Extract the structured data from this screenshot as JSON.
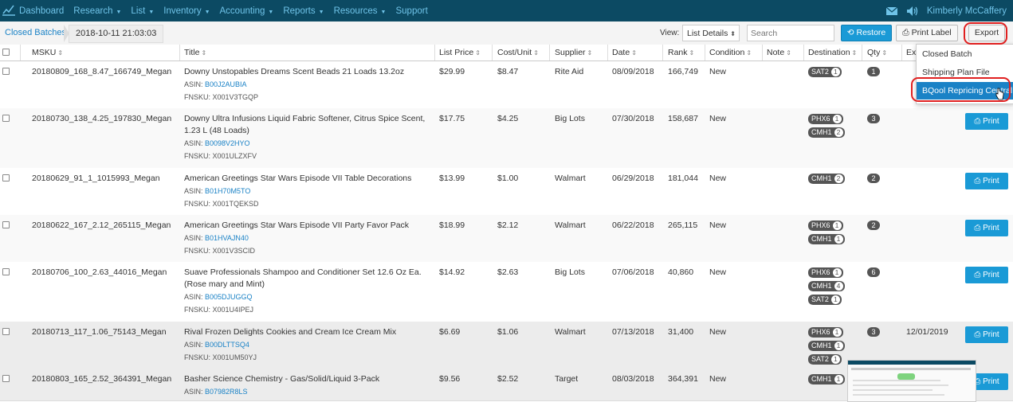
{
  "nav": {
    "menu": [
      {
        "label": "Dashboard",
        "caret": false
      },
      {
        "label": "Research",
        "caret": true
      },
      {
        "label": "List",
        "caret": true
      },
      {
        "label": "Inventory",
        "caret": true
      },
      {
        "label": "Accounting",
        "caret": true
      },
      {
        "label": "Reports",
        "caret": true
      },
      {
        "label": "Resources",
        "caret": true
      },
      {
        "label": "Support",
        "caret": false
      }
    ],
    "user": "Kimberly McCaffery"
  },
  "toolbar": {
    "breadcrumb": "Closed Batches",
    "batch": "2018-10-11 21:03:03",
    "view_label": "View:",
    "view_value": "List Details",
    "search_placeholder": "Search",
    "restore": "Restore",
    "print_label": "Print Label",
    "export": "Export"
  },
  "columns": [
    "MSKU",
    "Title",
    "List Price",
    "Cost/Unit",
    "Supplier",
    "Date",
    "Rank",
    "Condition",
    "Note",
    "Destination",
    "Qty",
    "Ex"
  ],
  "export_menu": {
    "items": [
      "Closed Batch",
      "Shipping Plan File",
      "BQool Repricing Central"
    ],
    "selected_index": 2
  },
  "print_label": "Print",
  "rows": [
    {
      "msku": "20180809_168_8.47_166749_Megan",
      "title": "Downy Unstopables Dreams Scent Beads 21 Loads 13.2oz",
      "asin": "B00J2AUBIA",
      "fnsku": "X001V3TGQP",
      "price": "$29.99",
      "cost": "$8.47",
      "supplier": "Rite Aid",
      "date": "08/09/2018",
      "rank": "166,749",
      "condition": "New",
      "destinations": [
        {
          "code": "SAT2",
          "n": "1"
        }
      ],
      "qty": "1",
      "expiry": "",
      "print": false
    },
    {
      "msku": "20180730_138_4.25_197830_Megan",
      "title": "Downy Ultra Infusions Liquid Fabric Softener, Citrus Spice Scent, 1.23 L (48 Loads)",
      "asin": "B0098V2HYO",
      "fnsku": "X001ULZXFV",
      "price": "$17.75",
      "cost": "$4.25",
      "supplier": "Big Lots",
      "date": "07/30/2018",
      "rank": "158,687",
      "condition": "New",
      "destinations": [
        {
          "code": "PHX6",
          "n": "1"
        },
        {
          "code": "CMH1",
          "n": "2"
        }
      ],
      "qty": "3",
      "expiry": "",
      "print": true
    },
    {
      "msku": "20180629_91_1_1015993_Megan",
      "title": "American Greetings Star Wars Episode VII Table Decorations",
      "asin": "B01H70M5TO",
      "fnsku": "X001TQEKSD",
      "price": "$13.99",
      "cost": "$1.00",
      "supplier": "Walmart",
      "date": "06/29/2018",
      "rank": "181,044",
      "condition": "New",
      "destinations": [
        {
          "code": "CMH1",
          "n": "2"
        }
      ],
      "qty": "2",
      "expiry": "",
      "print": true
    },
    {
      "msku": "20180622_167_2.12_265115_Megan",
      "title": "American Greetings Star Wars Episode VII Party Favor Pack",
      "asin": "B01HVAJN40",
      "fnsku": "X001V3SCID",
      "price": "$18.99",
      "cost": "$2.12",
      "supplier": "Walmart",
      "date": "06/22/2018",
      "rank": "265,115",
      "condition": "New",
      "destinations": [
        {
          "code": "PHX6",
          "n": "1"
        },
        {
          "code": "CMH1",
          "n": "1"
        }
      ],
      "qty": "2",
      "expiry": "",
      "print": true
    },
    {
      "msku": "20180706_100_2.63_44016_Megan",
      "title": "Suave Professionals Shampoo and Conditioner Set 12.6 Oz Ea. (Rose mary and Mint)",
      "asin": "B005DJUGGQ",
      "fnsku": "X001U4IPEJ",
      "price": "$14.92",
      "cost": "$2.63",
      "supplier": "Big Lots",
      "date": "07/06/2018",
      "rank": "40,860",
      "condition": "New",
      "destinations": [
        {
          "code": "PHX6",
          "n": "1"
        },
        {
          "code": "CMH1",
          "n": "4"
        },
        {
          "code": "SAT2",
          "n": "1"
        }
      ],
      "qty": "6",
      "expiry": "",
      "print": true
    },
    {
      "msku": "20180713_117_1.06_75143_Megan",
      "title": "Rival Frozen Delights Cookies and Cream Ice Cream Mix",
      "asin": "B00DLTTSQ4",
      "fnsku": "X001UM50YJ",
      "price": "$6.69",
      "cost": "$1.06",
      "supplier": "Walmart",
      "date": "07/13/2018",
      "rank": "31,400",
      "condition": "New",
      "destinations": [
        {
          "code": "PHX6",
          "n": "1"
        },
        {
          "code": "CMH1",
          "n": "1"
        },
        {
          "code": "SAT2",
          "n": "1"
        }
      ],
      "qty": "3",
      "expiry": "12/01/2019",
      "print": true
    },
    {
      "msku": "20180803_165_2.52_364391_Megan",
      "title": "Basher Science Chemistry - Gas/Solid/Liquid 3-Pack",
      "asin": "B07982R8LS",
      "fnsku": "",
      "price": "$9.56",
      "cost": "$2.52",
      "supplier": "Target",
      "date": "08/03/2018",
      "rank": "364,391",
      "condition": "New",
      "destinations": [
        {
          "code": "CMH1",
          "n": "1"
        }
      ],
      "qty": "",
      "expiry": "",
      "print": true
    }
  ],
  "colors": {
    "nav_bg": "#0c4a63",
    "nav_link": "#6fc3e8",
    "accent": "#1a9ad6",
    "link": "#1a82c6",
    "highlight": "#e02020"
  }
}
